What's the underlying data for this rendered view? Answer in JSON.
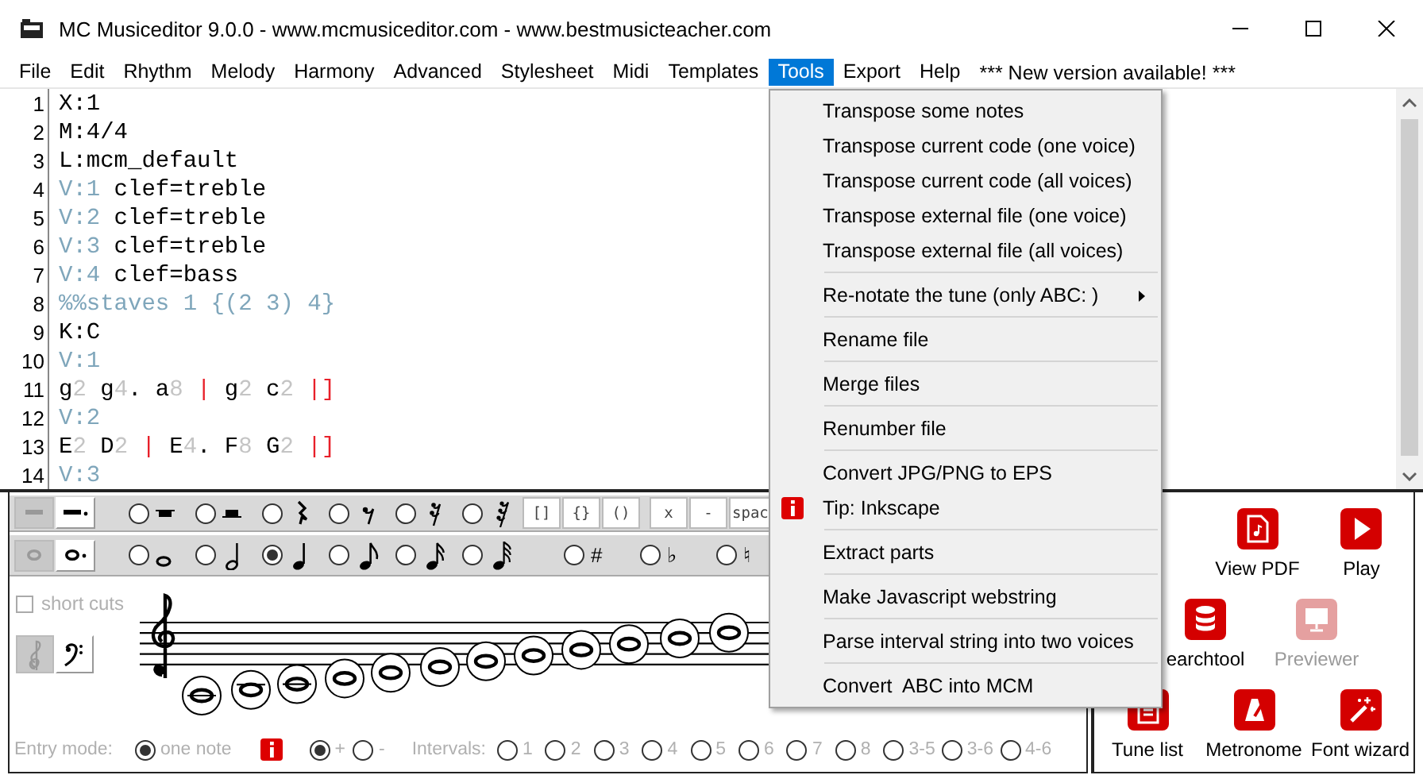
{
  "window": {
    "title": "MC Musiceditor 9.0.0 - www.mcmusiceditor.com - www.bestmusicteacher.com"
  },
  "menu_bar": {
    "items": [
      {
        "label": "File",
        "selected": false
      },
      {
        "label": "Edit",
        "selected": false
      },
      {
        "label": "Rhythm",
        "selected": false
      },
      {
        "label": "Melody",
        "selected": false
      },
      {
        "label": "Harmony",
        "selected": false
      },
      {
        "label": "Advanced",
        "selected": false
      },
      {
        "label": "Stylesheet",
        "selected": false
      },
      {
        "label": "Midi",
        "selected": false
      },
      {
        "label": "Templates",
        "selected": false
      },
      {
        "label": "Tools",
        "selected": true
      },
      {
        "label": "Export",
        "selected": false
      },
      {
        "label": "Help",
        "selected": false
      }
    ],
    "notice": "*** New version available! ***"
  },
  "editor": {
    "lines": [
      {
        "number": "1",
        "segments": [
          {
            "text": "X:1",
            "kind": "plain"
          }
        ]
      },
      {
        "number": "2",
        "segments": [
          {
            "text": "M:4/4",
            "kind": "plain"
          }
        ]
      },
      {
        "number": "3",
        "segments": [
          {
            "text": "L:mcm_default",
            "kind": "plain"
          }
        ]
      },
      {
        "number": "4",
        "segments": [
          {
            "text": "V:1",
            "kind": "voice"
          },
          {
            "text": " clef=treble",
            "kind": "plain"
          }
        ]
      },
      {
        "number": "5",
        "segments": [
          {
            "text": "V:2",
            "kind": "voice"
          },
          {
            "text": " clef=treble",
            "kind": "plain"
          }
        ]
      },
      {
        "number": "6",
        "segments": [
          {
            "text": "V:3",
            "kind": "voice"
          },
          {
            "text": " clef=treble",
            "kind": "plain"
          }
        ]
      },
      {
        "number": "7",
        "segments": [
          {
            "text": "V:4",
            "kind": "voice"
          },
          {
            "text": " clef=bass",
            "kind": "plain"
          }
        ]
      },
      {
        "number": "8",
        "segments": [
          {
            "text": "%%staves 1 {(2 3) 4}",
            "kind": "voice"
          }
        ]
      },
      {
        "number": "9",
        "segments": [
          {
            "text": "K:C",
            "kind": "plain"
          }
        ]
      },
      {
        "number": "10",
        "segments": [
          {
            "text": "V:1",
            "kind": "voice"
          }
        ]
      },
      {
        "number": "11",
        "segments": [
          {
            "text": "g",
            "kind": "plain"
          },
          {
            "text": "2",
            "kind": "duration"
          },
          {
            "text": " g",
            "kind": "plain"
          },
          {
            "text": "4",
            "kind": "duration"
          },
          {
            "text": ". a",
            "kind": "plain"
          },
          {
            "text": "8",
            "kind": "duration"
          },
          {
            "text": " |",
            "kind": "barline"
          },
          {
            "text": " g",
            "kind": "plain"
          },
          {
            "text": "2",
            "kind": "duration"
          },
          {
            "text": " c",
            "kind": "plain"
          },
          {
            "text": "2",
            "kind": "duration"
          },
          {
            "text": " |]",
            "kind": "barline"
          }
        ]
      },
      {
        "number": "12",
        "segments": [
          {
            "text": "V:2",
            "kind": "voice"
          }
        ]
      },
      {
        "number": "13",
        "segments": [
          {
            "text": "E",
            "kind": "plain"
          },
          {
            "text": "2",
            "kind": "duration"
          },
          {
            "text": " D",
            "kind": "plain"
          },
          {
            "text": "2",
            "kind": "duration"
          },
          {
            "text": " |",
            "kind": "barline"
          },
          {
            "text": " E",
            "kind": "plain"
          },
          {
            "text": "4",
            "kind": "duration"
          },
          {
            "text": ". F",
            "kind": "plain"
          },
          {
            "text": "8",
            "kind": "duration"
          },
          {
            "text": " G",
            "kind": "plain"
          },
          {
            "text": "2",
            "kind": "duration"
          },
          {
            "text": " |]",
            "kind": "barline"
          }
        ]
      },
      {
        "number": "14",
        "segments": [
          {
            "text": "V:3",
            "kind": "voice"
          }
        ]
      }
    ]
  },
  "tools_menu": {
    "items": [
      {
        "kind": "item",
        "label": "Transpose some notes"
      },
      {
        "kind": "item",
        "label": "Transpose current code (one voice)"
      },
      {
        "kind": "item",
        "label": "Transpose current code (all voices)"
      },
      {
        "kind": "item",
        "label": "Transpose external file (one voice)"
      },
      {
        "kind": "item",
        "label": "Transpose external file (all voices)"
      },
      {
        "kind": "separator"
      },
      {
        "kind": "submenu",
        "label": "Re-notate the tune (only ABC: )"
      },
      {
        "kind": "separator"
      },
      {
        "kind": "item",
        "label": "Rename file"
      },
      {
        "kind": "separator"
      },
      {
        "kind": "item",
        "label": "Merge files"
      },
      {
        "kind": "separator"
      },
      {
        "kind": "item",
        "label": "Renumber file"
      },
      {
        "kind": "separator"
      },
      {
        "kind": "item",
        "label": "Convert JPG/PNG to EPS"
      },
      {
        "kind": "tip",
        "label": "Tip: Inkscape"
      },
      {
        "kind": "separator"
      },
      {
        "kind": "item",
        "label": "Extract parts"
      },
      {
        "kind": "separator"
      },
      {
        "kind": "item",
        "label": "Make Javascript webstring"
      },
      {
        "kind": "separator"
      },
      {
        "kind": "item",
        "label": "Parse interval string into two voices"
      },
      {
        "kind": "separator"
      },
      {
        "kind": "item",
        "label": "Convert  ABC into MCM"
      }
    ]
  },
  "rest_toolbar": {
    "buttons": [
      {
        "kind": "plain",
        "selected": true
      },
      {
        "kind": "dotted",
        "selected": false
      }
    ],
    "options": [
      {
        "kind": "whole",
        "selected": false
      },
      {
        "kind": "half",
        "selected": false
      },
      {
        "kind": "quarter",
        "selected": false
      },
      {
        "kind": "eighth",
        "selected": false
      },
      {
        "kind": "sixteenth",
        "selected": false
      },
      {
        "kind": "thirtysecond",
        "selected": false
      }
    ],
    "keys": [
      "[]",
      "{}",
      "()",
      "x",
      "-",
      "spac"
    ]
  },
  "note_toolbar": {
    "buttons": [
      {
        "kind": "plain",
        "selected": true
      },
      {
        "kind": "dotted",
        "selected": false
      }
    ],
    "options": [
      {
        "kind": "whole",
        "selected": false
      },
      {
        "kind": "half",
        "selected": false
      },
      {
        "kind": "quarter",
        "selected": true
      },
      {
        "kind": "eighth",
        "selected": false
      },
      {
        "kind": "sixteenth",
        "selected": false
      },
      {
        "kind": "thirtysecond",
        "selected": false
      }
    ],
    "accidentals": [
      {
        "symbol": "#",
        "selected": false
      },
      {
        "symbol": "♭",
        "selected": false
      },
      {
        "symbol": "♮",
        "selected": false
      }
    ]
  },
  "staff_panel": {
    "short_cuts": {
      "label": "short cuts",
      "checked": false
    },
    "clefs": [
      {
        "kind": "treble",
        "selected": true
      },
      {
        "kind": "bass",
        "selected": false
      }
    ]
  },
  "entry_bar": {
    "mode_label": "Entry mode:",
    "mode": {
      "label": "one note",
      "selected": true
    },
    "direction": [
      {
        "label": "+",
        "selected": true
      },
      {
        "label": "-",
        "selected": false
      }
    ],
    "intervals_label": "Intervals:",
    "intervals": [
      {
        "label": "1",
        "selected": false
      },
      {
        "label": "2",
        "selected": false
      },
      {
        "label": "3",
        "selected": false
      },
      {
        "label": "4",
        "selected": false
      },
      {
        "label": "5",
        "selected": false
      },
      {
        "label": "6",
        "selected": false
      },
      {
        "label": "7",
        "selected": false
      },
      {
        "label": "8",
        "selected": false
      },
      {
        "label": "3-5",
        "selected": false
      },
      {
        "label": "3-6",
        "selected": false
      },
      {
        "label": "4-6",
        "selected": false
      }
    ]
  },
  "actions": {
    "rows": [
      {
        "buttons": [
          {
            "kind": "pdf",
            "label": "View PDF",
            "disabled": false
          },
          {
            "kind": "play",
            "label": "Play",
            "disabled": false
          }
        ]
      },
      {
        "buttons": [
          {
            "kind": "database",
            "label": "earchtool",
            "disabled": false
          },
          {
            "kind": "monitor",
            "label": "Previewer",
            "disabled": true
          }
        ]
      },
      {
        "buttons": [
          {
            "kind": "list",
            "label": "Tune list",
            "disabled": false
          },
          {
            "kind": "metronome",
            "label": "Metronome",
            "disabled": false
          },
          {
            "kind": "wand",
            "label": "Font wizard",
            "disabled": false
          }
        ]
      }
    ]
  }
}
